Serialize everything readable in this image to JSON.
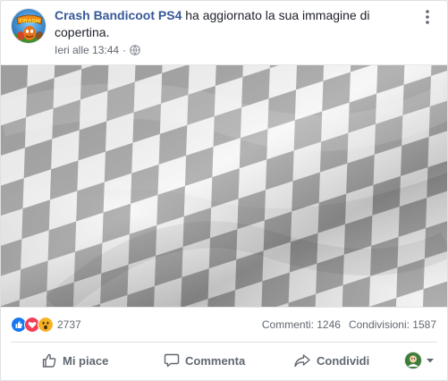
{
  "post": {
    "page_name": "Crash Bandicoot PS4",
    "action_text": "ha aggiornato la sua immagine di copertina.",
    "timestamp": "Ieri alle 13:44",
    "avatar_logo_text": "CRASH"
  },
  "stats": {
    "reaction_count": "2737",
    "comments": "Commenti: 1246",
    "shares": "Condivisioni: 1587"
  },
  "actions": {
    "like": "Mi piace",
    "comment": "Commenta",
    "share": "Condividi"
  },
  "icons": {
    "avatar": "crash-bandicoot-avatar",
    "privacy": "globe-icon",
    "more": "more-dots-icon",
    "like_reaction": "thumbs-up-reaction-icon",
    "love_reaction": "heart-reaction-icon",
    "wow_reaction": "wow-reaction-icon",
    "like_action": "thumbs-up-icon",
    "comment_action": "speech-bubble-icon",
    "share_action": "share-arrow-icon",
    "audience": "chevron-down-icon"
  },
  "colors": {
    "link_blue": "#365899",
    "like_blue": "#1877f2",
    "love_red": "#f33e58",
    "wow_yellow": "#f7b125",
    "muted_text": "#616770"
  }
}
